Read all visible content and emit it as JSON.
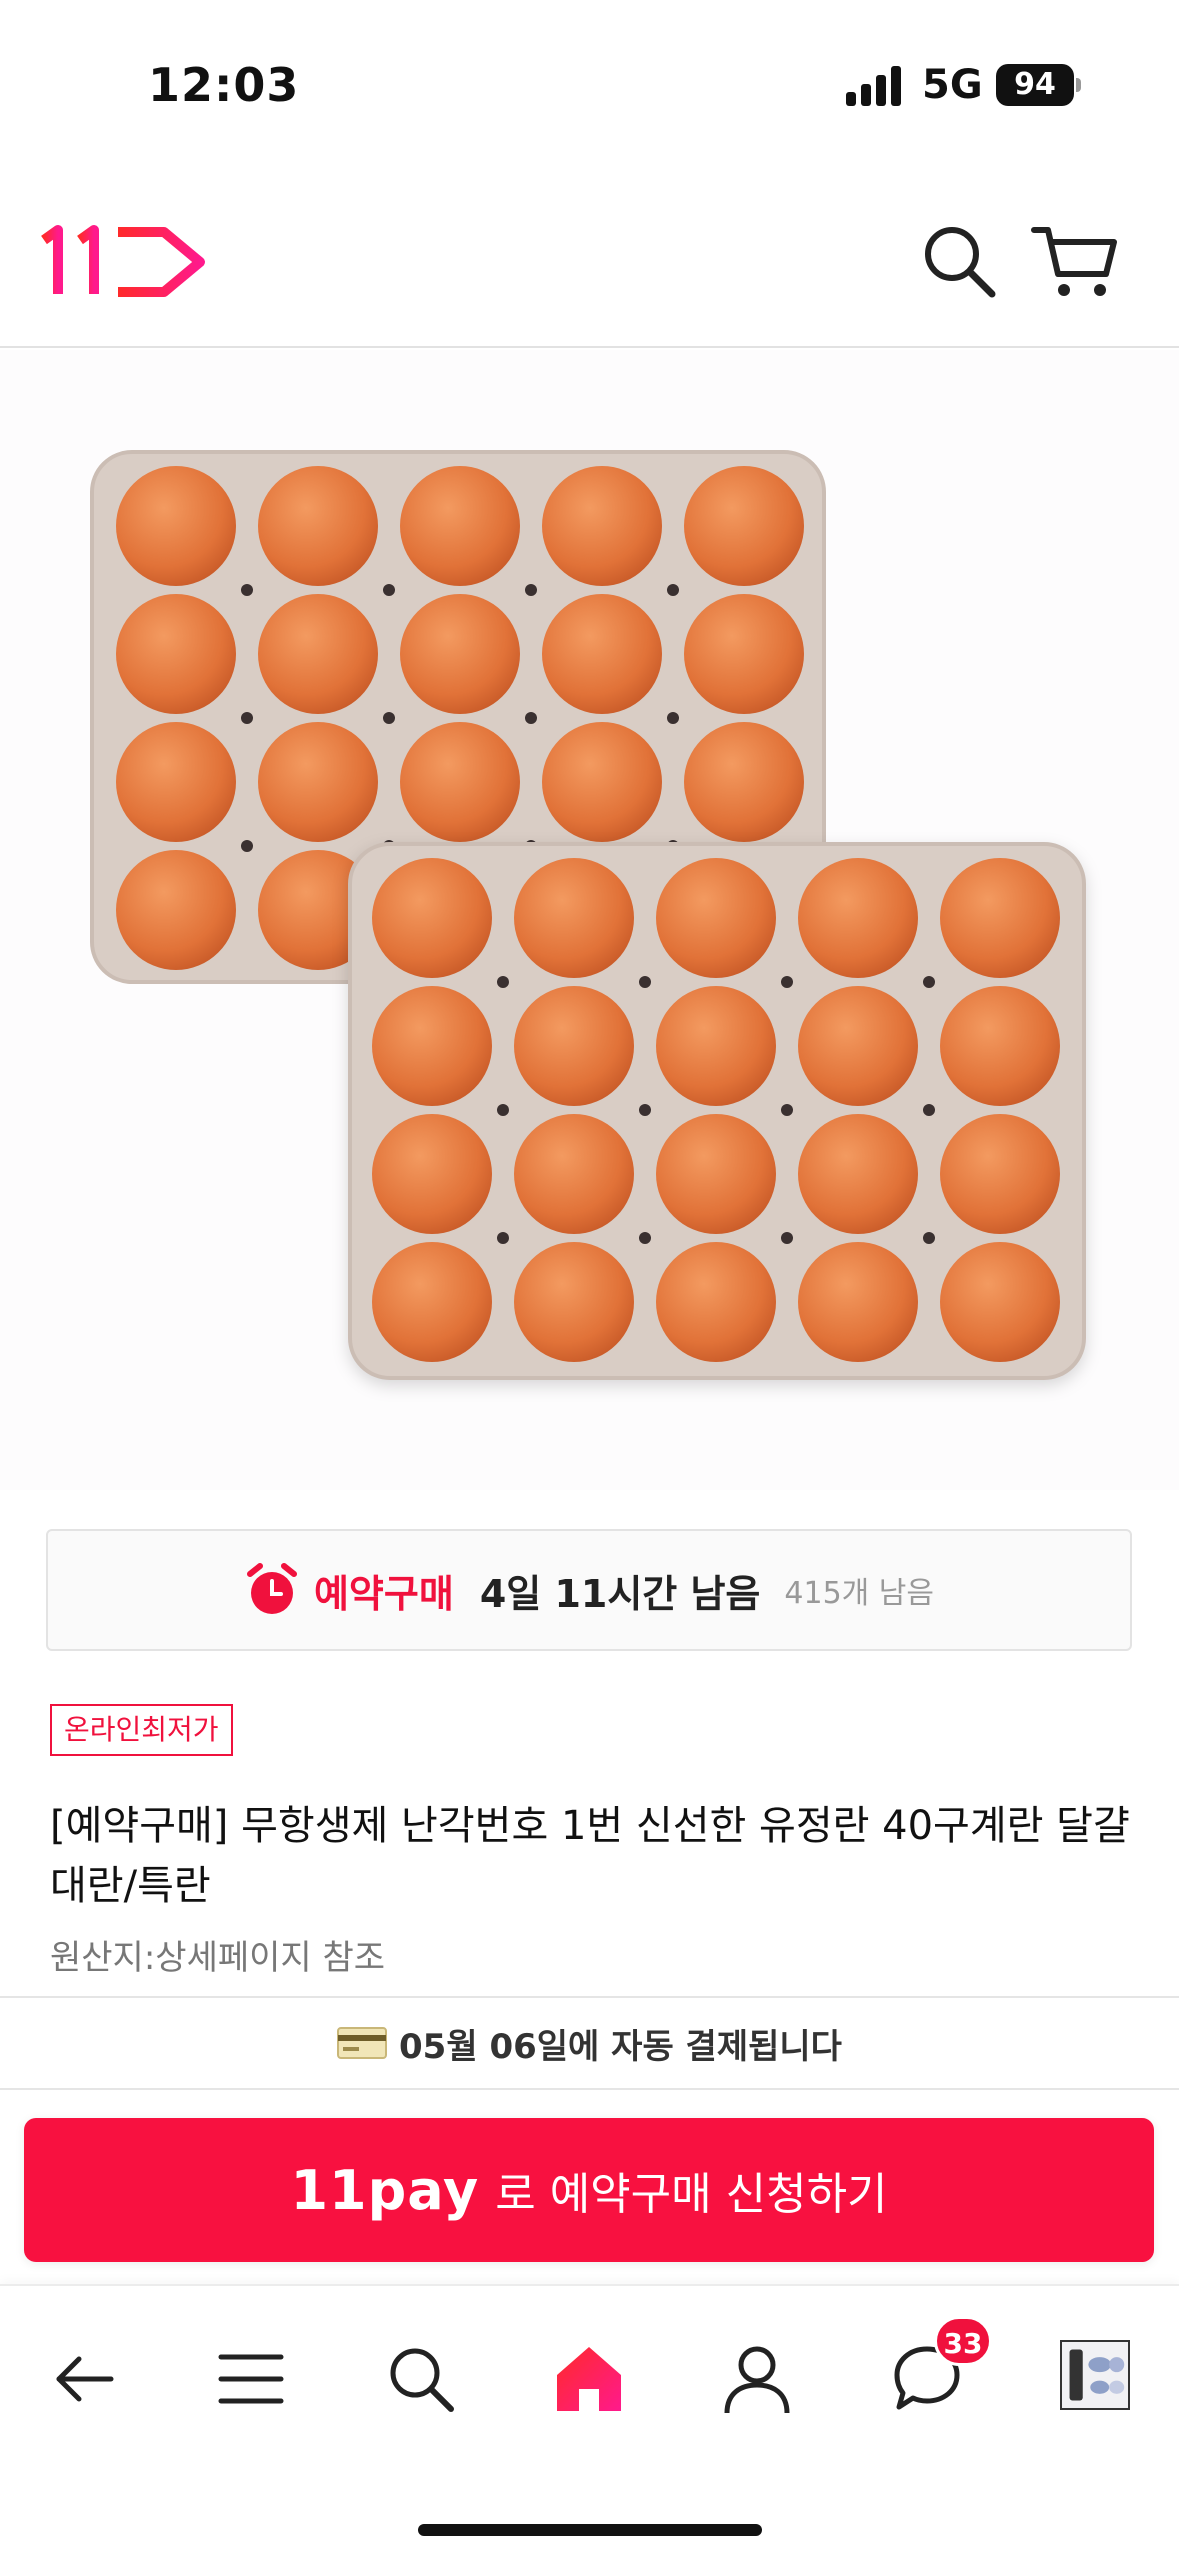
{
  "status_bar": {
    "time": "12:03",
    "network": "5G",
    "battery": "94"
  },
  "header": {
    "logo_icon": "11st-logo",
    "search_icon": "search-icon",
    "cart_icon": "cart-icon"
  },
  "product": {
    "image_icon": "egg-tray-image",
    "preorder": {
      "label": "예약구매",
      "time_left": "4일 11시간 남음",
      "stock": "415개 남음"
    },
    "tag": "온라인최저가",
    "title": "[예약구매] 무항생제 난각번호 1번 신선한 유정란 40구계란 달걀 대란/특란",
    "origin": "원산지:상세페이지 참조"
  },
  "autopay": {
    "text": "05월 06일에 자동 결제됩니다"
  },
  "cta": {
    "brand": "11pay",
    "text": "로 예약구매 신청하기"
  },
  "bottom_nav": {
    "items": [
      "back-icon",
      "menu-icon",
      "search-icon",
      "home-icon",
      "user-icon",
      "chat-icon",
      "recent-item-thumbnail"
    ],
    "chat_badge": "33"
  },
  "colors": {
    "brand_red": "#f81140",
    "accent_red": "#f0113d",
    "egg": "#e5773f",
    "tray": "#d8ccc4"
  }
}
